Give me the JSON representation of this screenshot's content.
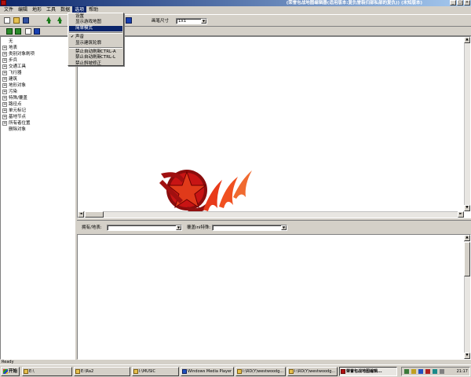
{
  "window": {
    "title": "(荣誉包战地图编辑器(适用版本:复仇誉裂归部私部的复仇)) (未知版本)"
  },
  "menubar": {
    "items": [
      {
        "label": "文件",
        "active": false
      },
      {
        "label": "编辑",
        "active": false
      },
      {
        "label": "地形",
        "active": false
      },
      {
        "label": "工具",
        "active": false
      },
      {
        "label": "数据",
        "active": false
      },
      {
        "label": "选项",
        "active": true
      },
      {
        "label": "帮助",
        "active": false
      }
    ]
  },
  "toolbar": {
    "brush_label": "画笔尺寸",
    "brush_value": "1x1"
  },
  "options_menu": {
    "items": [
      {
        "label": "设置",
        "checked": false,
        "highlighted": false,
        "shortcut": ""
      },
      {
        "label": "显示游戏地图",
        "checked": false,
        "highlighted": false,
        "shortcut": ""
      },
      {
        "label": "简单模式",
        "checked": false,
        "highlighted": true,
        "shortcut": ""
      },
      {
        "label": "声音",
        "checked": true,
        "highlighted": false,
        "shortcut": ""
      },
      {
        "label": "显示建筑轮廓",
        "checked": false,
        "highlighted": false,
        "shortcut": ""
      },
      {
        "label": "禁止自动刷新",
        "checked": false,
        "highlighted": false,
        "shortcut": "CTRL-A"
      },
      {
        "label": "禁止自动刷新",
        "checked": false,
        "highlighted": false,
        "shortcut": "CTRL-L"
      },
      {
        "label": "禁止斜坡修正",
        "checked": false,
        "highlighted": false,
        "shortcut": ""
      }
    ]
  },
  "tree": {
    "items": [
      {
        "label": "无",
        "expandable": false
      },
      {
        "label": "地表",
        "expandable": true
      },
      {
        "label": "类别对象刷项",
        "expandable": true
      },
      {
        "label": "步兵",
        "expandable": true
      },
      {
        "label": "交通工具",
        "expandable": true
      },
      {
        "label": "飞行器",
        "expandable": true
      },
      {
        "label": "建筑",
        "expandable": true
      },
      {
        "label": "地形对象",
        "expandable": true
      },
      {
        "label": "污染",
        "expandable": true
      },
      {
        "label": "特殊/覆盖",
        "expandable": true
      },
      {
        "label": "路径点",
        "expandable": true
      },
      {
        "label": "单元标记",
        "expandable": true
      },
      {
        "label": "基地节点",
        "expandable": true
      },
      {
        "label": "所有者位置",
        "expandable": true
      },
      {
        "label": "删除对象",
        "expandable": false
      }
    ]
  },
  "filter_bar": {
    "owner_label": "拥有/地表:",
    "owner_value": "",
    "ini_label": "覆盖ini特殊:",
    "ini_value": ""
  },
  "status": {
    "text": "Ready"
  },
  "taskbar": {
    "start_label": "开始",
    "quick_label": "E:\\",
    "tasks": [
      {
        "label": "E:\\Ra2",
        "pressed": false
      },
      {
        "label": "I:\\MUSIC",
        "pressed": false
      },
      {
        "label": "Windows Media Player",
        "pressed": false
      },
      {
        "label": "I:\\RD(Y)westwoodg...",
        "pressed": false
      },
      {
        "label": "I:\\RD(Y)westwoodg...",
        "pressed": false
      },
      {
        "label": "荣誉包战地图编辑...",
        "pressed": true
      }
    ],
    "clock": "21:17"
  },
  "colors": {
    "titlebar_start": "#0a246a",
    "titlebar_end": "#a6caf0",
    "highlight": "#0a246a",
    "soviet_red": "#c81414"
  },
  "icons": {
    "app": "app-icon",
    "splash": "soviet-emblem-logo"
  }
}
